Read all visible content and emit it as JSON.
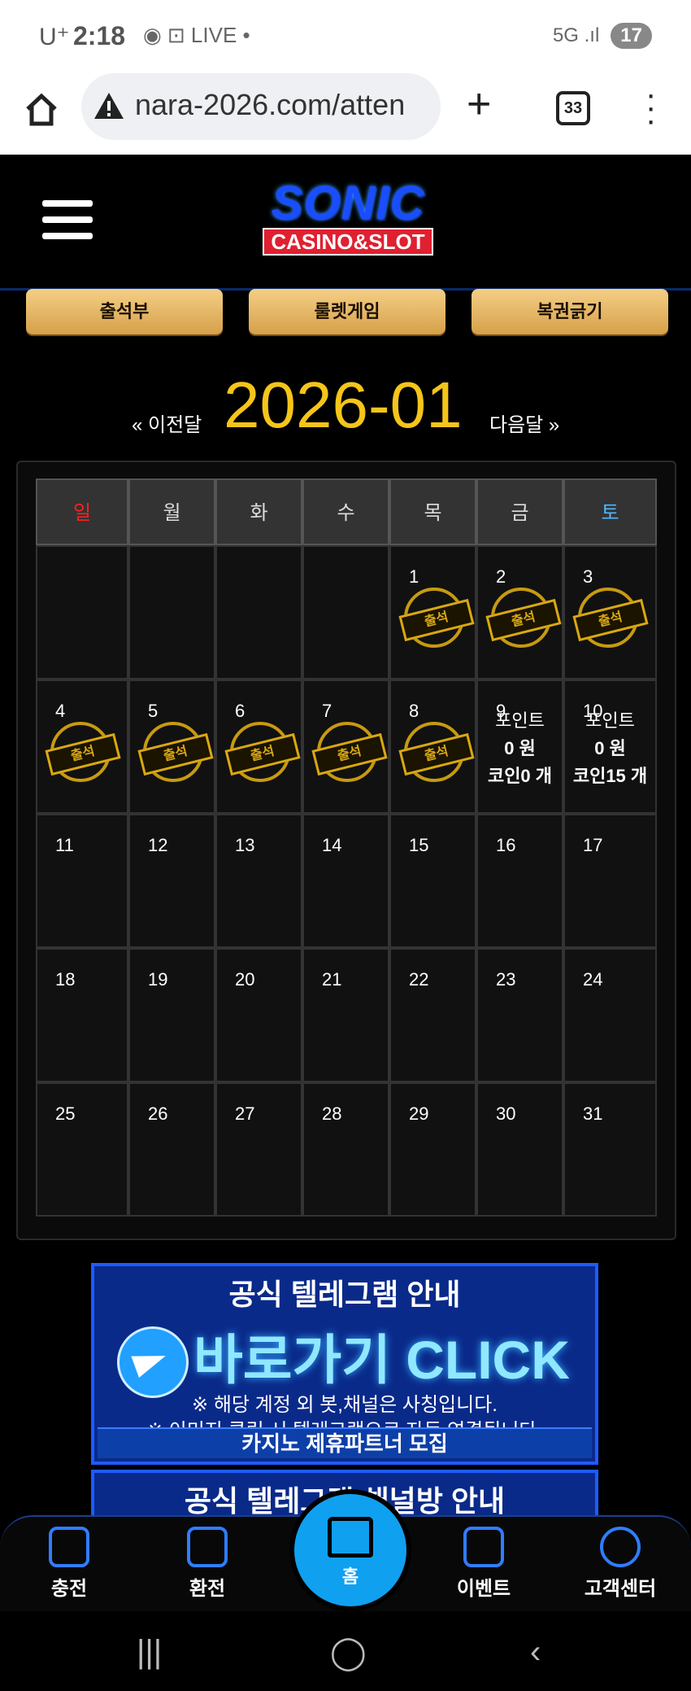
{
  "status_bar": {
    "carrier": "U⁺",
    "time": "2:18",
    "icons": "◉ ⊡ LIVE •",
    "network": "5G .ıl",
    "battery": "17"
  },
  "browser": {
    "url": "nara-2026.com/atten",
    "tab_count": "33"
  },
  "logo": {
    "sonic": "SONIC",
    "casino": "CASINO&SLOT"
  },
  "top_nav": [
    "출석부",
    "룰렛게임",
    "복권긁기"
  ],
  "calendar": {
    "prev_label": "« 이전달",
    "month_label": "2026-01",
    "next_label": "다음달 »",
    "stamp_label": "출석",
    "days_header": [
      "일",
      "월",
      "화",
      "수",
      "목",
      "금",
      "토"
    ],
    "weeks": [
      [
        "",
        "",
        "",
        "",
        "1",
        "2",
        "3"
      ],
      [
        "4",
        "5",
        "6",
        "7",
        "8",
        "9",
        "10"
      ],
      [
        "11",
        "12",
        "13",
        "14",
        "15",
        "16",
        "17"
      ],
      [
        "18",
        "19",
        "20",
        "21",
        "22",
        "23",
        "24"
      ],
      [
        "25",
        "26",
        "27",
        "28",
        "29",
        "30",
        "31"
      ]
    ],
    "attended": [
      "1",
      "2",
      "3",
      "4",
      "5",
      "6",
      "7",
      "8"
    ],
    "info": {
      "9": {
        "l1": "포인트",
        "l2": "0 원",
        "l3": "코인0 개"
      },
      "10": {
        "l1": "포인트",
        "l2": "0 원",
        "l3": "코인15 개"
      }
    }
  },
  "banner": {
    "title": "공식 텔레그램 안내",
    "cta": "바로가기 CLICK",
    "line1": "※ 해당 계정 외 봇,채널은 사칭입니다.",
    "line2": "※ 이미지 클릭 시 텔레그램으로 자동 연결됩니다.",
    "partner": "카지노 제휴파트너 모집"
  },
  "banner2": {
    "title": "공식 텔레그램 채널방 안내"
  },
  "bottom_nav": {
    "charge": "충전",
    "exchange": "환전",
    "home": "홈",
    "event": "이벤트",
    "support": "고객센터"
  },
  "colors": {
    "gold": "#f5c518",
    "sunday": "#ff2020",
    "saturday": "#4db8ff",
    "accent": "#1e5bff"
  }
}
